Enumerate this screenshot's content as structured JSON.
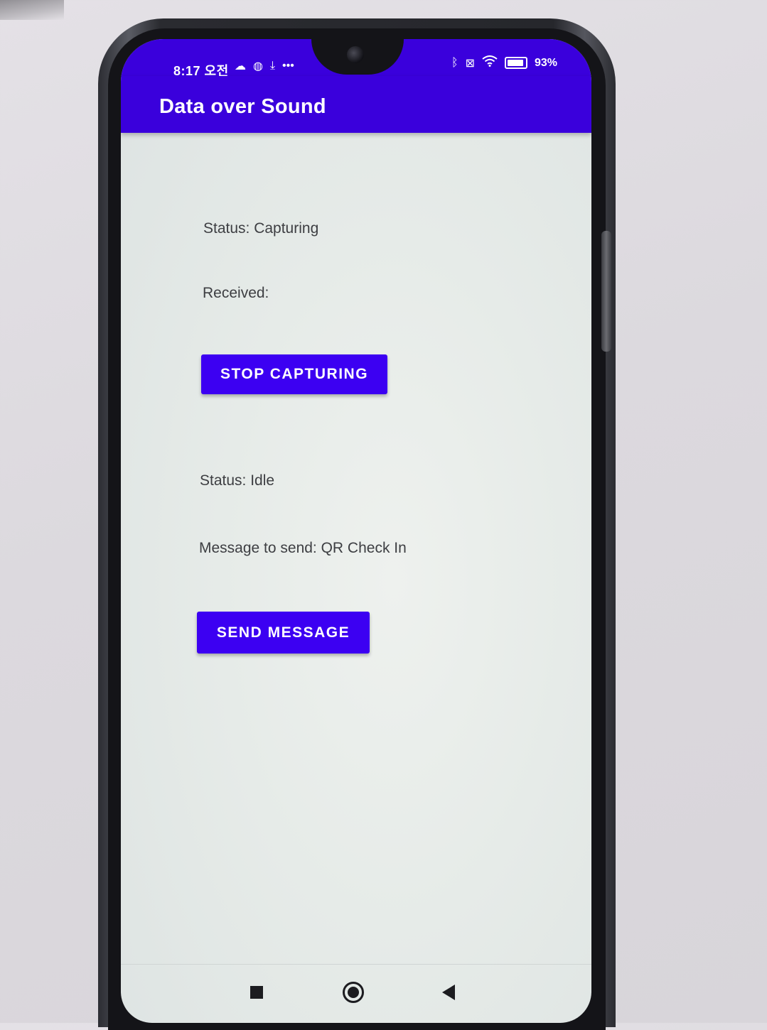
{
  "status_bar": {
    "time": "8:17 오전",
    "left_icons": [
      "cloud-icon",
      "globe-icon",
      "download-icon",
      "more-dots-icon"
    ],
    "right_icons": [
      "bluetooth-icon",
      "no-sim-icon",
      "wifi-icon",
      "battery-icon"
    ],
    "battery_percent": "93%",
    "battery_level": 0.93
  },
  "app_bar": {
    "title": "Data over Sound",
    "color": "#3a00dc"
  },
  "receiver": {
    "status": "Status: Capturing",
    "received": "Received:",
    "button_label": "Stop Capturing"
  },
  "sender": {
    "status": "Status: Idle",
    "message": "Message to send: QR Check In",
    "button_label": "Send Message"
  },
  "nav_bar": {
    "buttons": [
      "recents-icon",
      "home-icon",
      "back-icon"
    ]
  },
  "colors": {
    "accent": "#3c00f2",
    "primary": "#3a00dc"
  }
}
